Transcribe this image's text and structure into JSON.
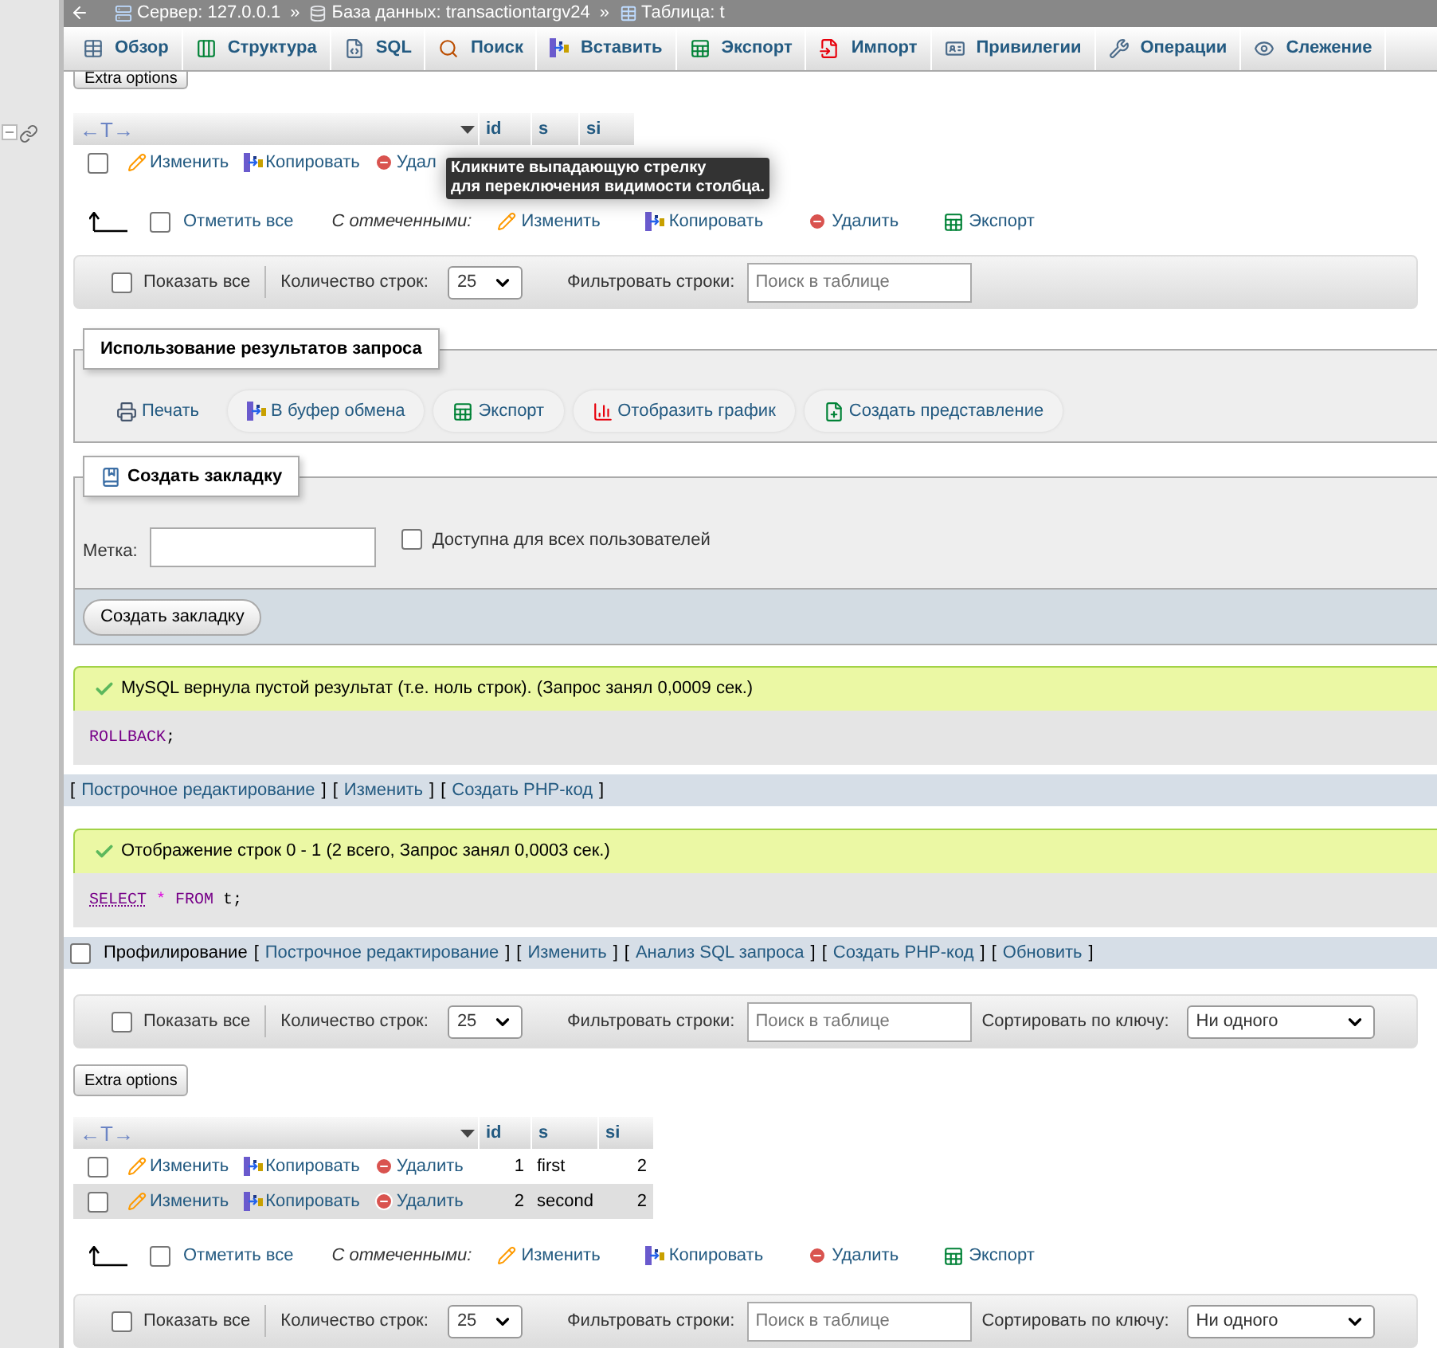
{
  "breadcrumb": [
    {
      "kind": "server",
      "label": "Сервер: 127.0.0.1"
    },
    {
      "kind": "database",
      "separator": "»",
      "label": "База данных: transactiontargv24"
    },
    {
      "kind": "table",
      "separator": "»",
      "label": "Таблица: t"
    }
  ],
  "tabs": [
    {
      "kind": "browse",
      "label": "Обзор",
      "selected": false
    },
    {
      "kind": "structure",
      "label": "Структура",
      "selected": false
    },
    {
      "kind": "sql",
      "label": "SQL",
      "selected": false
    },
    {
      "kind": "search",
      "label": "Поиск",
      "selected": false
    },
    {
      "kind": "insert",
      "label": "Вставить",
      "selected": false
    },
    {
      "kind": "export",
      "label": "Экспорт",
      "selected": false
    },
    {
      "kind": "import",
      "label": "Импорт",
      "selected": false
    },
    {
      "kind": "privileges",
      "label": "Привилегии",
      "selected": false
    },
    {
      "kind": "operations",
      "label": "Операции",
      "selected": false
    },
    {
      "kind": "tracking",
      "label": "Слежение",
      "selected": false
    }
  ],
  "top_results": {
    "extra_options": "Extra options",
    "grid": {
      "header_glyph": "←T→",
      "columns": [
        "id",
        "s",
        "si"
      ],
      "rows": [
        {
          "checked": false,
          "highlighted": false,
          "actions": [
            {
              "kind": "edit",
              "label": "Изменить"
            },
            {
              "kind": "copy",
              "label": "Копировать"
            },
            {
              "kind": "delete",
              "label": "Удал"
            }
          ],
          "cells": []
        }
      ]
    },
    "tooltip": [
      "Кликните выпадающую стрелку",
      "для переключения видимости столбца."
    ],
    "bulk": {
      "check_all": "Отметить все",
      "checked": false,
      "with_selected": "С отмеченными:",
      "actions": [
        {
          "kind": "edit",
          "label": "Изменить"
        },
        {
          "kind": "copy",
          "label": "Копировать"
        },
        {
          "kind": "delete",
          "label": "Удалить"
        },
        {
          "kind": "export",
          "label": "Экспорт"
        }
      ]
    },
    "navbar": {
      "show_all": "Показать все",
      "show_all_checked": false,
      "rows_label": "Количество строк:",
      "rows_value": "25",
      "filter_label": "Фильтровать строки:",
      "filter_placeholder": "Поиск в таблице"
    }
  },
  "query_ops": {
    "title": "Использование результатов запроса",
    "buttons": [
      {
        "kind": "print",
        "label": "Печать"
      },
      {
        "kind": "copy",
        "label": "В буфер обмена"
      },
      {
        "kind": "export",
        "label": "Экспорт"
      },
      {
        "kind": "chart",
        "label": "Отобразить график"
      },
      {
        "kind": "view",
        "label": "Создать представление"
      }
    ]
  },
  "bookmark": {
    "title": "Создать закладку",
    "label": "Метка:",
    "public_label": "Доступна для всех пользователей",
    "public_checked": false,
    "submit": "Создать закладку"
  },
  "messages": [
    {
      "text": "MySQL вернула пустой результат (т.е. ноль строк). (Запрос занял 0,0009 сек.)",
      "sql": [
        {
          "kind": "keyword",
          "text": "ROLLBACK"
        },
        {
          "kind": "punctuation",
          "text": ";"
        }
      ],
      "bracket_open": "[",
      "bracket_close": "]",
      "links": [
        "Построчное редактирование",
        "Изменить",
        "Создать PHP-код"
      ]
    },
    {
      "text": "Отображение строк 0 - 1 (2 всего, Запрос занял 0,0003 сек.)",
      "sql": [
        {
          "kind": "keyword",
          "text": "SELECT",
          "underline": true
        },
        {
          "kind": "operator",
          "text": "*"
        },
        {
          "kind": "keyword",
          "text": "FROM"
        },
        {
          "kind": "plain",
          "text": "t;"
        }
      ],
      "profiling": "Профилирование",
      "profiling_checked": false,
      "bracket_open": "[",
      "bracket_close": "]",
      "links": [
        "Построчное редактирование",
        "Изменить",
        "Анализ SQL запроса",
        "Создать PHP-код",
        "Обновить"
      ]
    }
  ],
  "results": {
    "navbar_top": {
      "show_all": "Показать все",
      "show_all_checked": false,
      "rows_label": "Количество строк:",
      "rows_value": "25",
      "filter_label": "Фильтровать строки:",
      "filter_placeholder": "Поиск в таблице",
      "sort_label": "Сортировать по ключу:",
      "sort_value": "Ни одного"
    },
    "extra_options": "Extra options",
    "grid": {
      "header_glyph": "←T→",
      "columns": [
        "id",
        "s",
        "si"
      ],
      "rows": [
        {
          "checked": false,
          "highlighted": false,
          "actions": [
            {
              "kind": "edit",
              "label": "Изменить"
            },
            {
              "kind": "copy",
              "label": "Копировать"
            },
            {
              "kind": "delete",
              "label": "Удалить"
            }
          ],
          "cells": [
            "1",
            "first",
            "2"
          ]
        },
        {
          "checked": false,
          "highlighted": true,
          "actions": [
            {
              "kind": "edit",
              "label": "Изменить"
            },
            {
              "kind": "copy",
              "label": "Копировать"
            },
            {
              "kind": "delete",
              "label": "Удалить"
            }
          ],
          "cells": [
            "2",
            "second",
            "2"
          ]
        }
      ]
    },
    "bulk": {
      "check_all": "Отметить все",
      "checked": false,
      "with_selected": "С отмеченными:",
      "actions": [
        {
          "kind": "edit",
          "label": "Изменить"
        },
        {
          "kind": "copy",
          "label": "Копировать"
        },
        {
          "kind": "delete",
          "label": "Удалить"
        },
        {
          "kind": "export",
          "label": "Экспорт"
        }
      ]
    },
    "navbar_bottom": {
      "show_all": "Показать все",
      "show_all_checked": false,
      "rows_label": "Количество строк:",
      "rows_value": "25",
      "filter_label": "Фильтровать строки:",
      "filter_placeholder": "Поиск в таблице",
      "sort_label": "Сортировать по ключу:",
      "sort_value": "Ни одного"
    }
  }
}
